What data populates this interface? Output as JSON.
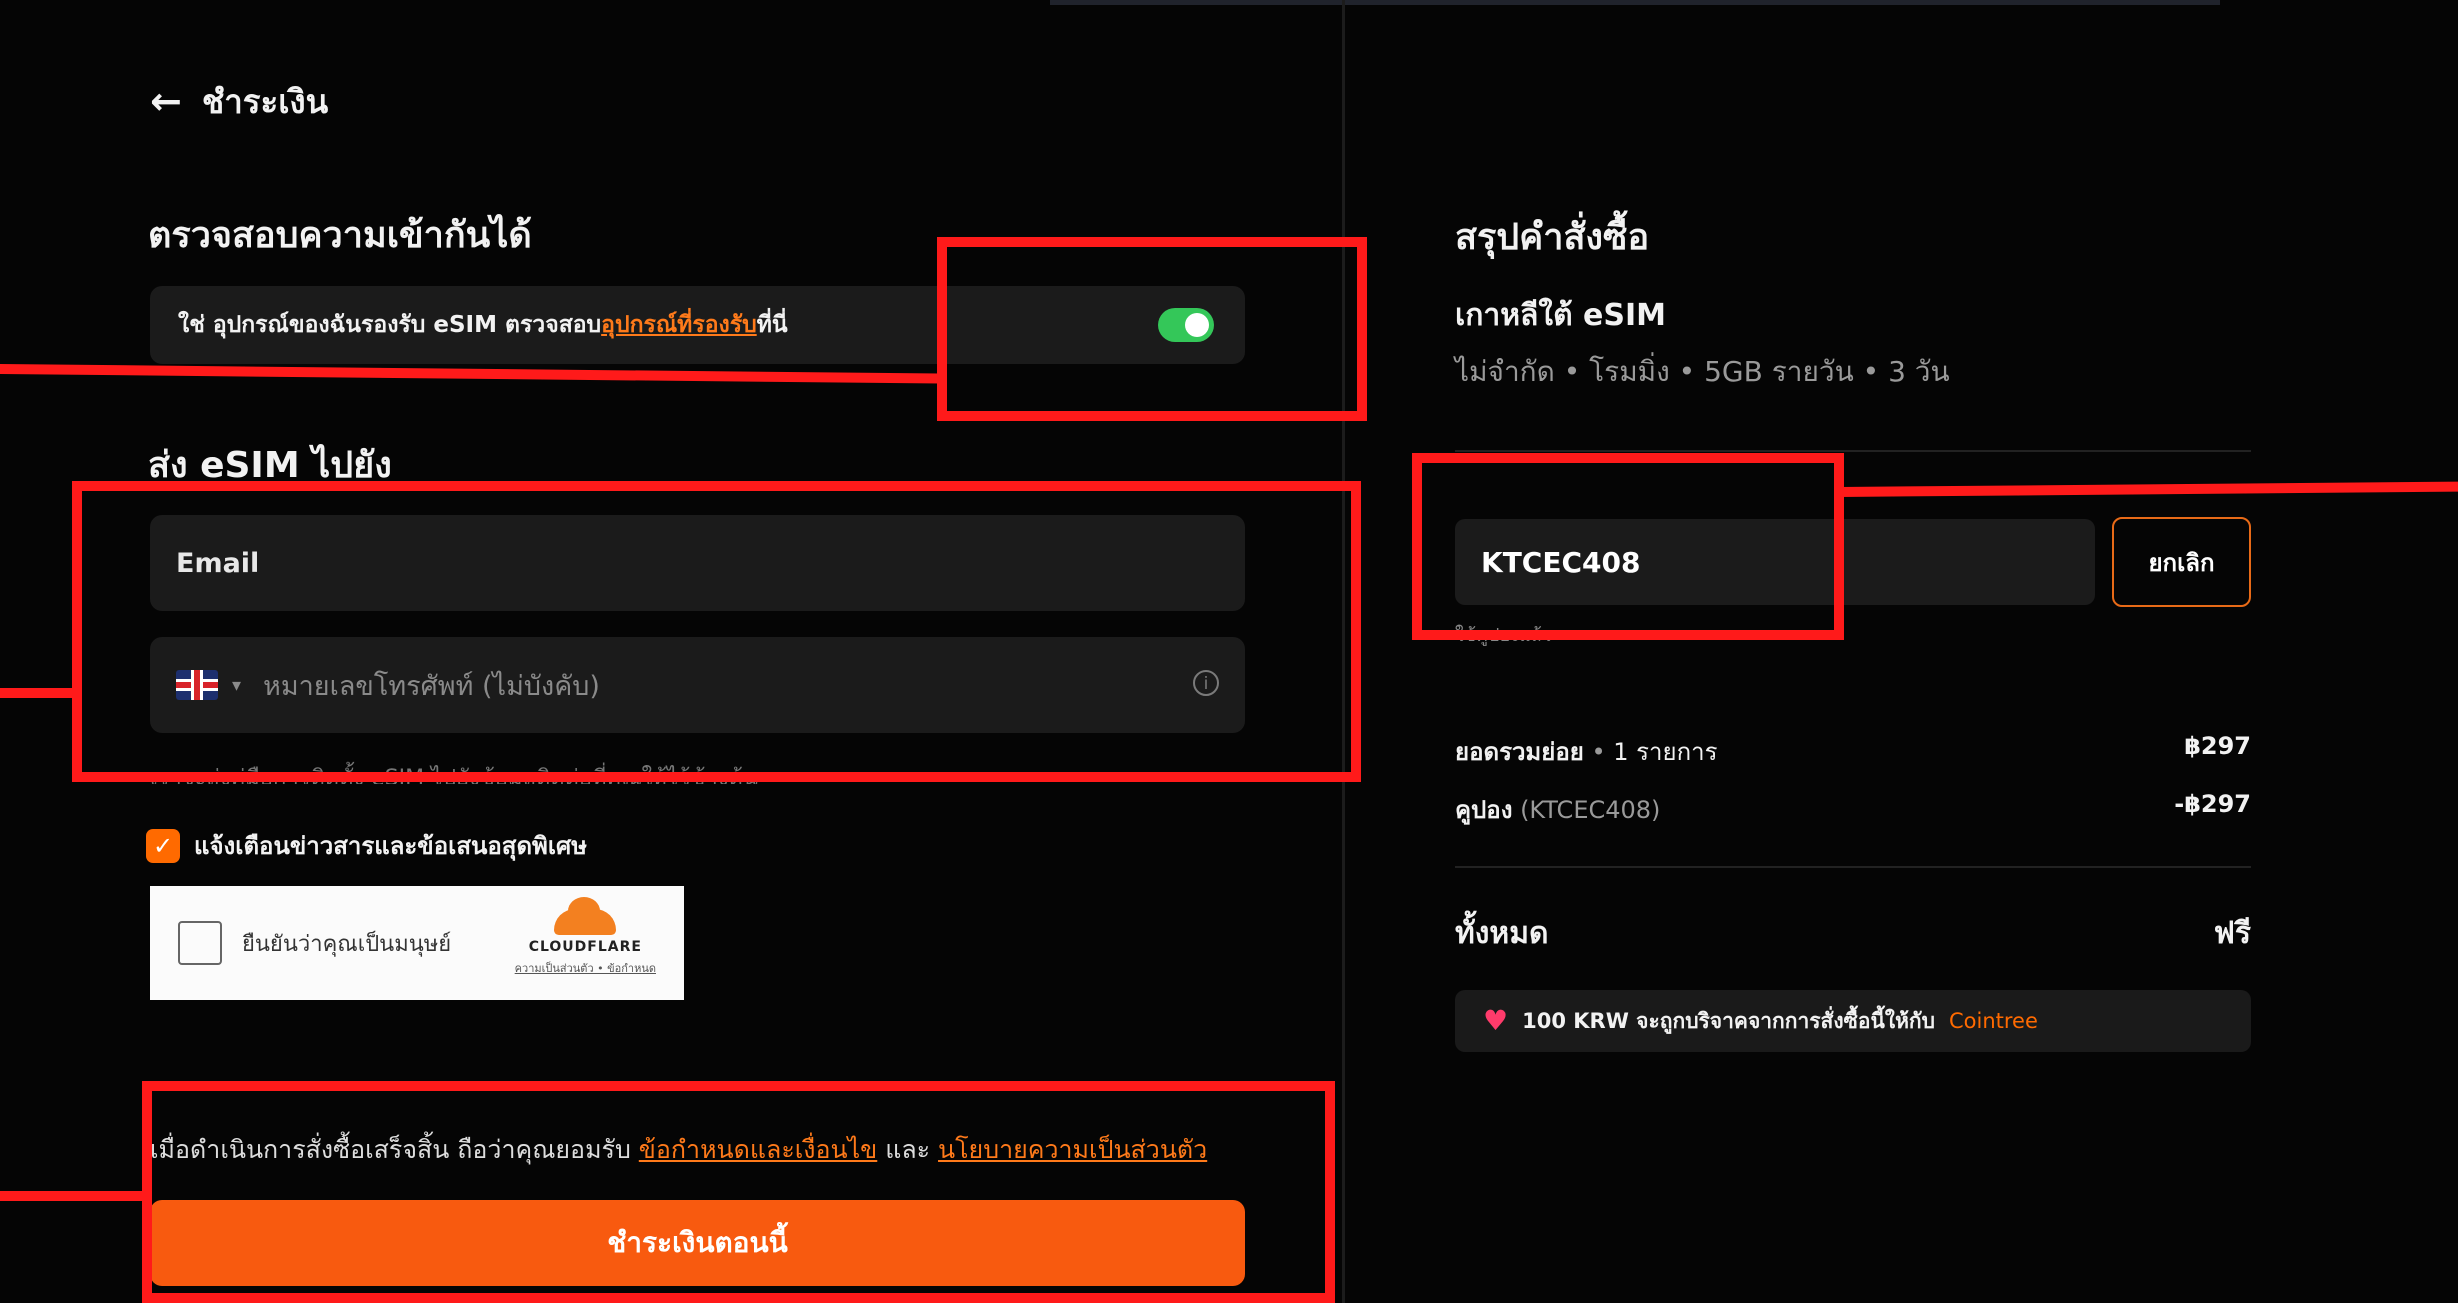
{
  "header": {
    "back_label": "ชำระเงิน"
  },
  "compatibility": {
    "title": "ตรวจสอบความเข้ากันได้",
    "text_before": "ใช่ อุปกรณ์ของฉันรองรับ eSIM ตรวจสอบ",
    "link": "อุปกรณ์ที่รองรับ",
    "text_after": "ที่นี่",
    "toggle_on": true
  },
  "send": {
    "title": "ส่ง eSIM ไปยัง",
    "email_placeholder": "Email",
    "phone_placeholder": "หมายเลขโทรศัพท์ (ไม่บังคับ)",
    "hint": "เราจะส่งคู่มือการติดตั้ง eSIM ไปยังข้อมูลติดต่อที่คุณให้ไว้ข้างต้น",
    "newsletter_label": "แจ้งเตือนข่าวสารและข้อเสนอสุดพิเศษ",
    "newsletter_checked": true
  },
  "captcha": {
    "label": "ยืนยันว่าคุณเป็นมนุษย์",
    "brand": "CLOUDFLARE",
    "links": "ความเป็นส่วนตัว • ข้อกำหนด"
  },
  "terms": {
    "text_before": "เมื่อดำเนินการสั่งซื้อเสร็จสิ้น ถือว่าคุณยอมรับ ",
    "link1": "ข้อกำหนดและเงื่อนไข",
    "middle": " และ ",
    "link2": "นโยบายความเป็นส่วนตัว"
  },
  "pay_button": "ชำระเงินตอนนี้",
  "summary": {
    "title": "สรุปคำสั่งซื้อ",
    "product": "เกาหลีใต้ eSIM",
    "product_desc": "ไม่จำกัด • โรมมิ่ง • 5GB รายวัน • 3 วัน",
    "coupon_code": "KTCEC408",
    "cancel_label": "ยกเลิก",
    "coupon_applied": "ใช้คูปองแล้ว",
    "subtotal_label": "ยอดรวมย่อย",
    "subtotal_items": "1 รายการ",
    "subtotal_value": "฿297",
    "coupon_label": "คูปอง",
    "coupon_code_paren": "(KTCEC408)",
    "coupon_value": "-฿297",
    "total_label": "ทั้งหมด",
    "total_value": "ฟรี",
    "donation_text": "100 KRW จะถูกบริจาคจากการสั่งซื้อนี้ให้กับ",
    "donation_brand": "Cointree"
  },
  "colors": {
    "accent": "#f85a0f",
    "toggle": "#34c759",
    "annotation": "#ff1a1a"
  }
}
